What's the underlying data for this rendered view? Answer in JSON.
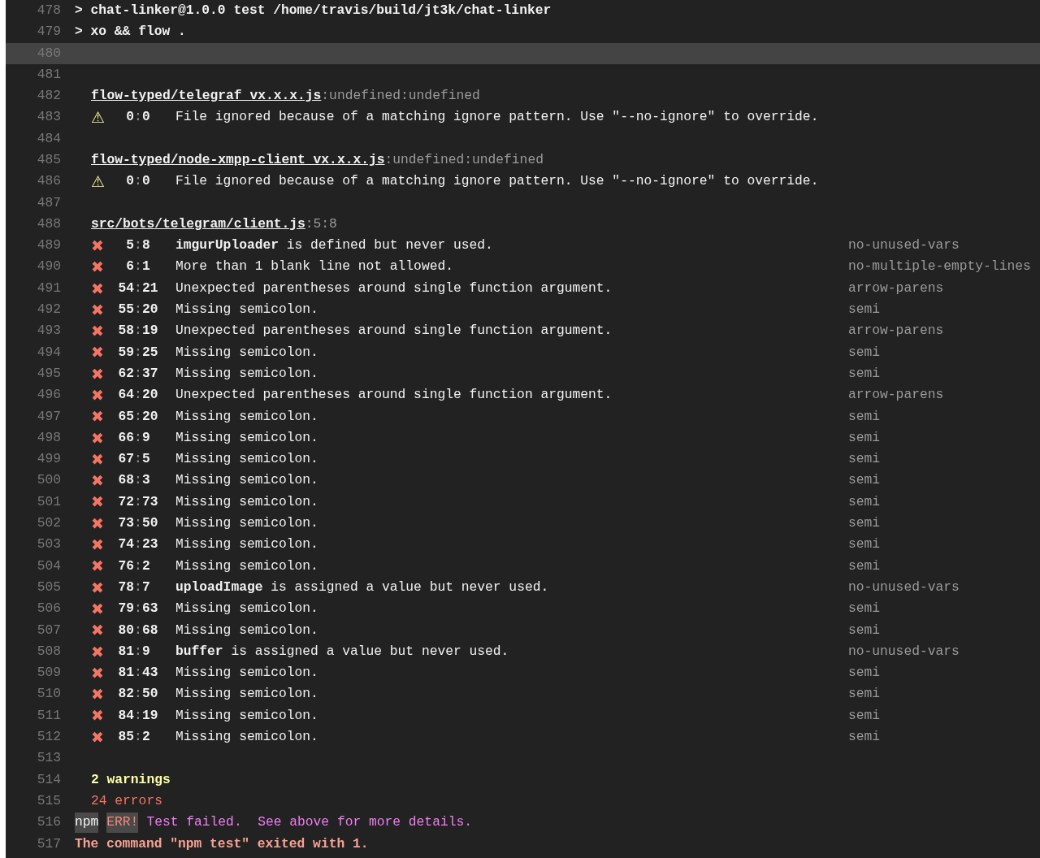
{
  "lines": [
    {
      "number": "478",
      "selected": false,
      "kind": "command",
      "text": "> chat-linker@1.0.0 test /home/travis/build/jt3k/chat-linker"
    },
    {
      "number": "479",
      "selected": false,
      "kind": "command",
      "text": "> xo && flow ."
    },
    {
      "number": "480",
      "selected": true,
      "kind": "blank"
    },
    {
      "number": "481",
      "selected": false,
      "kind": "blank"
    },
    {
      "number": "482",
      "selected": false,
      "kind": "file",
      "path": "flow-typed/telegraf_vx.x.x.js",
      "suffix": ":undefined:undefined"
    },
    {
      "number": "483",
      "selected": false,
      "kind": "warning",
      "icon": "⚠",
      "line": "0",
      "separator": ":",
      "col": "0",
      "message": "File ignored because of a matching ignore pattern. Use \"--no-ignore\" to override."
    },
    {
      "number": "484",
      "selected": false,
      "kind": "blank"
    },
    {
      "number": "485",
      "selected": false,
      "kind": "file",
      "path": "flow-typed/node-xmpp-client_vx.x.x.js",
      "suffix": ":undefined:undefined"
    },
    {
      "number": "486",
      "selected": false,
      "kind": "warning",
      "icon": "⚠",
      "line": "0",
      "separator": ":",
      "col": "0",
      "message": "File ignored because of a matching ignore pattern. Use \"--no-ignore\" to override."
    },
    {
      "number": "487",
      "selected": false,
      "kind": "blank"
    },
    {
      "number": "488",
      "selected": false,
      "kind": "file",
      "path": "src/bots/telegram/client.js",
      "suffix": ":5:8"
    },
    {
      "number": "489",
      "selected": false,
      "kind": "error",
      "icon": "✖",
      "line": "5",
      "separator": ":",
      "col": "8",
      "message": "**imgurUploader** is defined but never used.",
      "rule": "no-unused-vars"
    },
    {
      "number": "490",
      "selected": false,
      "kind": "error",
      "icon": "✖",
      "line": "6",
      "separator": ":",
      "col": "1",
      "message": "More than 1 blank line not allowed.",
      "rule": "no-multiple-empty-lines"
    },
    {
      "number": "491",
      "selected": false,
      "kind": "error",
      "icon": "✖",
      "line": "54",
      "separator": ":",
      "col": "21",
      "message": "Unexpected parentheses around single function argument.",
      "rule": "arrow-parens"
    },
    {
      "number": "492",
      "selected": false,
      "kind": "error",
      "icon": "✖",
      "line": "55",
      "separator": ":",
      "col": "20",
      "message": "Missing semicolon.",
      "rule": "semi"
    },
    {
      "number": "493",
      "selected": false,
      "kind": "error",
      "icon": "✖",
      "line": "58",
      "separator": ":",
      "col": "19",
      "message": "Unexpected parentheses around single function argument.",
      "rule": "arrow-parens"
    },
    {
      "number": "494",
      "selected": false,
      "kind": "error",
      "icon": "✖",
      "line": "59",
      "separator": ":",
      "col": "25",
      "message": "Missing semicolon.",
      "rule": "semi"
    },
    {
      "number": "495",
      "selected": false,
      "kind": "error",
      "icon": "✖",
      "line": "62",
      "separator": ":",
      "col": "37",
      "message": "Missing semicolon.",
      "rule": "semi"
    },
    {
      "number": "496",
      "selected": false,
      "kind": "error",
      "icon": "✖",
      "line": "64",
      "separator": ":",
      "col": "20",
      "message": "Unexpected parentheses around single function argument.",
      "rule": "arrow-parens"
    },
    {
      "number": "497",
      "selected": false,
      "kind": "error",
      "icon": "✖",
      "line": "65",
      "separator": ":",
      "col": "20",
      "message": "Missing semicolon.",
      "rule": "semi"
    },
    {
      "number": "498",
      "selected": false,
      "kind": "error",
      "icon": "✖",
      "line": "66",
      "separator": ":",
      "col": "9",
      "message": "Missing semicolon.",
      "rule": "semi"
    },
    {
      "number": "499",
      "selected": false,
      "kind": "error",
      "icon": "✖",
      "line": "67",
      "separator": ":",
      "col": "5",
      "message": "Missing semicolon.",
      "rule": "semi"
    },
    {
      "number": "500",
      "selected": false,
      "kind": "error",
      "icon": "✖",
      "line": "68",
      "separator": ":",
      "col": "3",
      "message": "Missing semicolon.",
      "rule": "semi"
    },
    {
      "number": "501",
      "selected": false,
      "kind": "error",
      "icon": "✖",
      "line": "72",
      "separator": ":",
      "col": "73",
      "message": "Missing semicolon.",
      "rule": "semi"
    },
    {
      "number": "502",
      "selected": false,
      "kind": "error",
      "icon": "✖",
      "line": "73",
      "separator": ":",
      "col": "50",
      "message": "Missing semicolon.",
      "rule": "semi"
    },
    {
      "number": "503",
      "selected": false,
      "kind": "error",
      "icon": "✖",
      "line": "74",
      "separator": ":",
      "col": "23",
      "message": "Missing semicolon.",
      "rule": "semi"
    },
    {
      "number": "504",
      "selected": false,
      "kind": "error",
      "icon": "✖",
      "line": "76",
      "separator": ":",
      "col": "2",
      "message": "Missing semicolon.",
      "rule": "semi"
    },
    {
      "number": "505",
      "selected": false,
      "kind": "error",
      "icon": "✖",
      "line": "78",
      "separator": ":",
      "col": "7",
      "message": "**uploadImage** is assigned a value but never used.",
      "rule": "no-unused-vars"
    },
    {
      "number": "506",
      "selected": false,
      "kind": "error",
      "icon": "✖",
      "line": "79",
      "separator": ":",
      "col": "63",
      "message": "Missing semicolon.",
      "rule": "semi"
    },
    {
      "number": "507",
      "selected": false,
      "kind": "error",
      "icon": "✖",
      "line": "80",
      "separator": ":",
      "col": "68",
      "message": "Missing semicolon.",
      "rule": "semi"
    },
    {
      "number": "508",
      "selected": false,
      "kind": "error",
      "icon": "✖",
      "line": "81",
      "separator": ":",
      "col": "9",
      "message": "**buffer** is assigned a value but never used.",
      "rule": "no-unused-vars"
    },
    {
      "number": "509",
      "selected": false,
      "kind": "error",
      "icon": "✖",
      "line": "81",
      "separator": ":",
      "col": "43",
      "message": "Missing semicolon.",
      "rule": "semi"
    },
    {
      "number": "510",
      "selected": false,
      "kind": "error",
      "icon": "✖",
      "line": "82",
      "separator": ":",
      "col": "50",
      "message": "Missing semicolon.",
      "rule": "semi"
    },
    {
      "number": "511",
      "selected": false,
      "kind": "error",
      "icon": "✖",
      "line": "84",
      "separator": ":",
      "col": "19",
      "message": "Missing semicolon.",
      "rule": "semi"
    },
    {
      "number": "512",
      "selected": false,
      "kind": "error",
      "icon": "✖",
      "line": "85",
      "separator": ":",
      "col": "2",
      "message": "Missing semicolon.",
      "rule": "semi"
    },
    {
      "number": "513",
      "selected": false,
      "kind": "blank"
    },
    {
      "number": "514",
      "selected": false,
      "kind": "warning_count",
      "text": "2 warnings"
    },
    {
      "number": "515",
      "selected": false,
      "kind": "error_count",
      "text": "24 errors"
    },
    {
      "number": "516",
      "selected": false,
      "kind": "npm_error",
      "prefix": "npm",
      "tag": "ERR!",
      "text": "Test failed.  See above for more details."
    },
    {
      "number": "517",
      "selected": false,
      "kind": "exit",
      "text": "The command \"npm test\" exited with 1."
    }
  ]
}
